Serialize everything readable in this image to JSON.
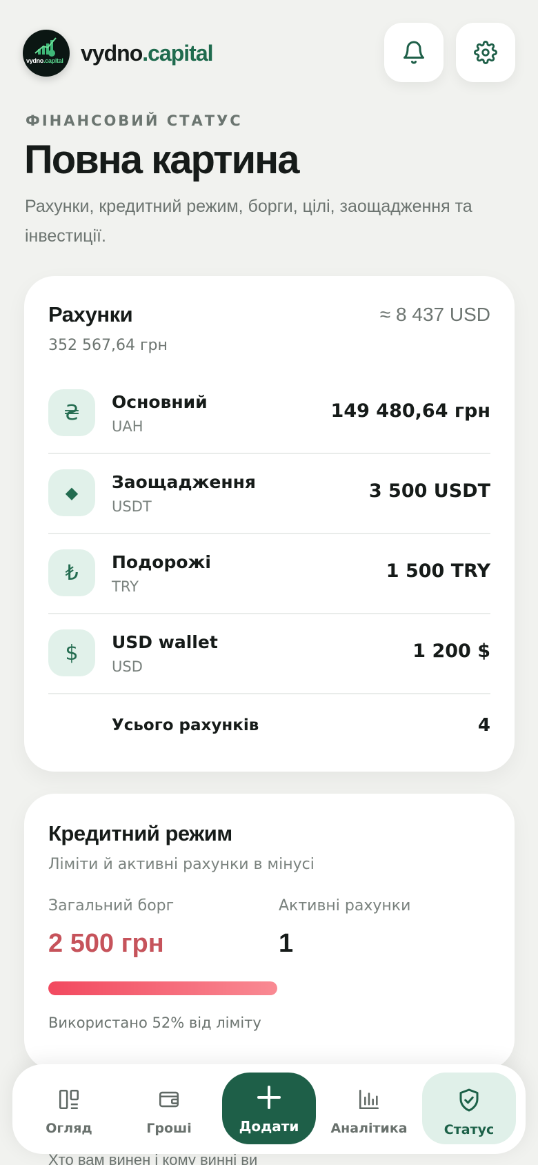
{
  "header": {
    "logo_text": "vydno.capital",
    "brand_name": "vydno",
    "brand_accent": ".capital",
    "notifications_icon": "bell-icon",
    "settings_icon": "gear-icon"
  },
  "intro": {
    "eyebrow": "ФІНАНСОВИЙ СТАТУС",
    "title": "Повна картина",
    "subtitle": "Рахунки, кредитний режим, борги, цілі, заощадження та інвестиції."
  },
  "accounts": {
    "title": "Рахунки",
    "total_uah": "352 567,64 грн",
    "total_usd": "≈ 8 437 USD",
    "items": [
      {
        "icon": "₴",
        "name": "Основний",
        "currency": "UAH",
        "amount": "149 480,64 грн"
      },
      {
        "icon": "◆",
        "name": "Заощадження",
        "currency": "USDT",
        "amount": "3 500 USDT"
      },
      {
        "icon": "₺",
        "name": "Подорожі",
        "currency": "TRY",
        "amount": "1 500 TRY"
      },
      {
        "icon": "$",
        "name": "USD wallet",
        "currency": "USD",
        "amount": "1 200 $"
      }
    ],
    "count_label": "Усього рахунків",
    "count_value": "4"
  },
  "credit": {
    "title": "Кредитний режим",
    "subtitle": "Ліміти й активні рахунки в мінусі",
    "debt_label": "Загальний борг",
    "debt_value": "2 500 грн",
    "active_label": "Активні рахунки",
    "active_value": "1",
    "usage_percent": 52,
    "usage_text": "Використано 52% від ліміту"
  },
  "next_section_peek": "Хто вам винен і кому винні ви",
  "nav": {
    "items": [
      {
        "label": "Огляд",
        "icon": "dashboard-icon"
      },
      {
        "label": "Гроші",
        "icon": "wallet-icon"
      },
      {
        "label": "Додати",
        "icon": "plus-icon"
      },
      {
        "label": "Аналітика",
        "icon": "bar-chart-icon"
      },
      {
        "label": "Статус",
        "icon": "shield-check-icon"
      }
    ],
    "active": "Статус"
  },
  "colors": {
    "brand": "#1e5f48",
    "debt": "#c6535b",
    "icon_bg": "#e1f1ea"
  }
}
